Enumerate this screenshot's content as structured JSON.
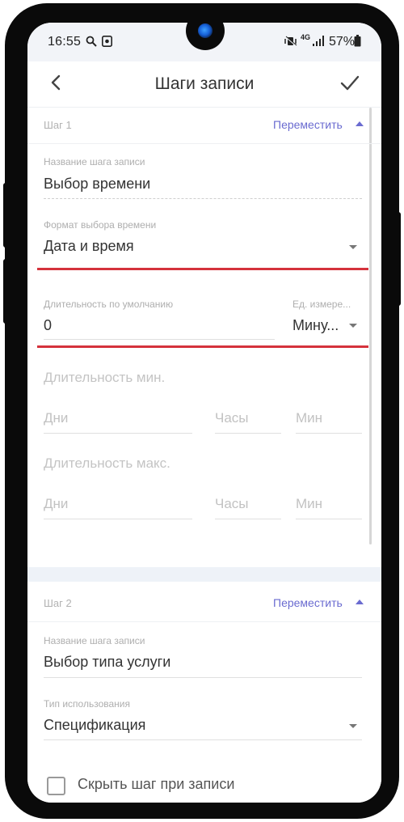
{
  "status_bar": {
    "time": "16:55",
    "icons": [
      "search-icon",
      "record-icon",
      "mute-vibrate-icon",
      "4g-icon",
      "signal-icon",
      "battery-icon"
    ],
    "network": "4G",
    "battery": "57%"
  },
  "app_bar": {
    "title": "Шаги записи",
    "back_icon": "back-chevron-icon",
    "confirm_icon": "check-icon"
  },
  "step1": {
    "number": "Шаг 1",
    "move_label": "Переместить",
    "name_label": "Название шага записи",
    "name_value": "Выбор времени",
    "time_format_label": "Формат выбора времени",
    "time_format_value": "Дата и время",
    "default_duration_label": "Длительность по умолчанию",
    "default_duration_value": "0",
    "unit_label": "Ед. измере...",
    "unit_value": "Мину...",
    "min_duration_title": "Длительность мин.",
    "max_duration_title": "Длительность макс.",
    "days_placeholder": "Дни",
    "hours_placeholder": "Часы",
    "minutes_placeholder": "Мин"
  },
  "step2": {
    "number": "Шаг 2",
    "move_label": "Переместить",
    "name_label": "Название шага записи",
    "name_value": "Выбор типа услуги",
    "usage_type_label": "Тип использования",
    "usage_type_value": "Спецификация",
    "hide_step_label": "Скрыть шаг при записи",
    "hide_step_checked": false
  },
  "colors": {
    "accent": "#6a6bd0",
    "highlight_line": "#d5323c",
    "status_bar_bg": "#f2f4f8"
  }
}
